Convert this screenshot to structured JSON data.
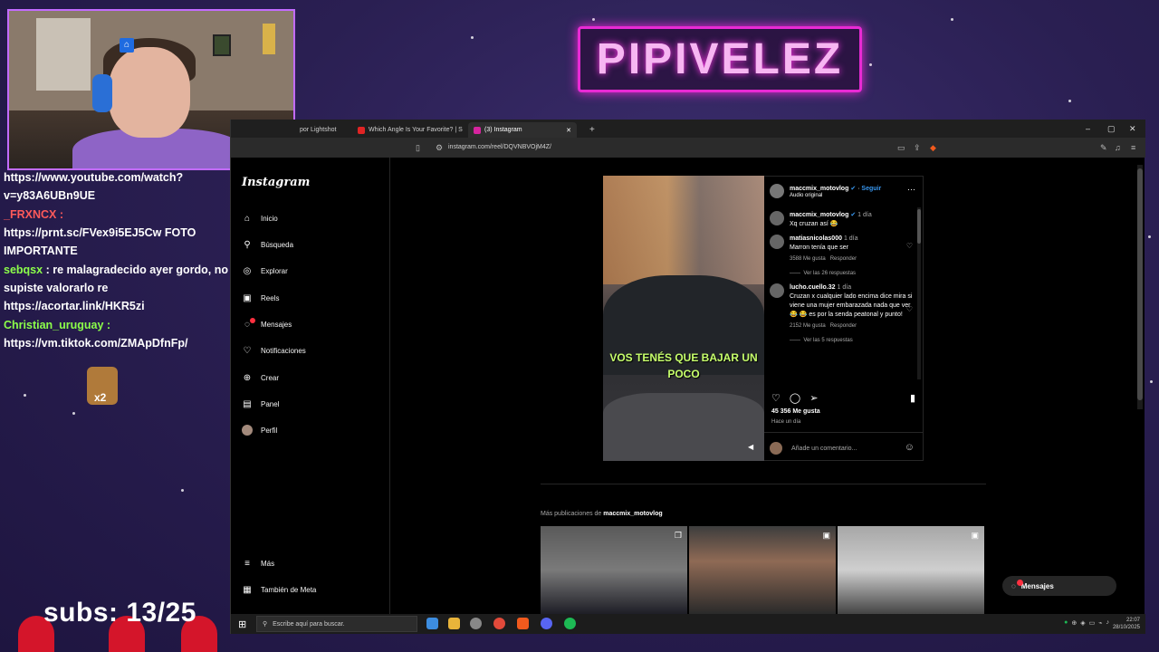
{
  "overlay": {
    "channel_logo": "PIPIVELEZ",
    "subs_text": "subs: 13/25",
    "emote_multiplier": "x2"
  },
  "chat": [
    {
      "user": "",
      "text": "https://www.youtube.com/watch?v=y83A6UBn9UE"
    },
    {
      "user": "_FRXNCX :",
      "text": "https://prnt.sc/FVex9i5EJ5Cw FOTO IMPORTANTE"
    },
    {
      "user": "sebqsx",
      "text": ": re malagradecido ayer gordo, no supiste valorarlo re"
    },
    {
      "user": "",
      "text": "https://acortar.link/HKR5zi"
    },
    {
      "user": "Christian_uruguay :",
      "text": "https://vm.tiktok.com/ZMApDfnFp/"
    }
  ],
  "browser": {
    "tabs": [
      {
        "label": "por Lightshot"
      },
      {
        "label": "Which Angle Is Your Favorite? | S"
      },
      {
        "label": "(3) Instagram"
      }
    ],
    "url": "instagram.com/reel/DQVNBVOjM4Z/"
  },
  "instagram": {
    "logo": "Instagram",
    "nav": [
      {
        "label": "Inicio",
        "icon": "home-icon"
      },
      {
        "label": "Búsqueda",
        "icon": "search-icon"
      },
      {
        "label": "Explorar",
        "icon": "compass-icon"
      },
      {
        "label": "Reels",
        "icon": "reels-icon"
      },
      {
        "label": "Mensajes",
        "icon": "messenger-icon"
      },
      {
        "label": "Notificaciones",
        "icon": "heart-icon"
      },
      {
        "label": "Crear",
        "icon": "plus-icon"
      },
      {
        "label": "Panel",
        "icon": "dashboard-icon"
      },
      {
        "label": "Perfil",
        "icon": "avatar-icon"
      }
    ],
    "nav_more": "Más",
    "nav_meta": "También de Meta",
    "post": {
      "caption": "VOS TENÉS QUE BAJAR UN POCO",
      "author": "maccmix_motovlog",
      "follow": "Seguir",
      "audio": "Audio original",
      "comments": [
        {
          "user": "maccmix_motovlog",
          "time": "1 día",
          "text": "Xq cruzan así 😂",
          "likes": "",
          "reply": ""
        },
        {
          "user": "matiasnicolas000",
          "time": "1 día",
          "text": "Marron tenía que ser",
          "likes": "3588 Me gusta",
          "reply": "Responder",
          "replies": "Ver las 26 respuestas"
        },
        {
          "user": "lucho.cuello.32",
          "time": "1 día",
          "text": "Cruzan x cualquier lado encima dice mira si viene una mujer embarazada nada que ver 😂 😂 es por la senda peatonal y punto!",
          "likes": "2152 Me gusta",
          "reply": "Responder",
          "replies": "Ver las 5 respuestas"
        }
      ],
      "likes_count": "45 356 Me gusta",
      "posted": "Hace un día",
      "add_comment": "Añade un comentario..."
    },
    "more_prefix": "Más publicaciones de",
    "more_user": "maccmix_motovlog",
    "messages_pill": "Mensajes"
  },
  "taskbar": {
    "search_placeholder": "Escribe aquí para buscar.",
    "time": "22:07",
    "date": "28/10/2025"
  }
}
